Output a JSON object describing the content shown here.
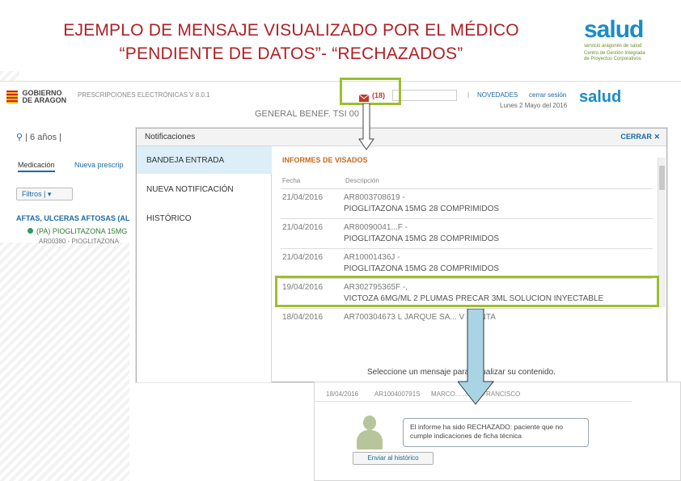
{
  "slide": {
    "title_line1": "EJEMPLO DE MENSAJE VISUALIZADO POR EL MÉDICO",
    "title_line2": "“PENDIENTE DE DATOS”- “RECHAZADOS”",
    "logo_text": "salud",
    "logo_sub": "servicio aragonés de salud",
    "logo_sub2": "Centro de Gestión Integrada de Proyectos Corporativos"
  },
  "app": {
    "org_logo_line1": "GOBIERNO",
    "org_logo_line2": "DE ARAGON",
    "app_title": "PRESCRIPCIONES ELECTRÓNICAS V 8.0.1",
    "notif_count": "(18)",
    "novedades": "NOVEDADES",
    "logout": "cerrar sesión",
    "date": "Lunes 2 Mayo del 2016",
    "patient_age": "6 años",
    "header_gray_text": "GENERAL BENEF. TSI 00",
    "tab_medicacion": "Medicación",
    "tab_nueva": "Nueva prescrip",
    "filter_btn": "Filtros",
    "section_left": "AFTAS, ULCERAS AFTOSAS (AL",
    "left_item1": "(PA) PIOGLITAZONA 15MG",
    "left_item2": "AR00380 - PIOGLITAZONA"
  },
  "dialog": {
    "title": "Notificaciones",
    "close_label": "CERRAR",
    "menu": [
      {
        "label": "BANDEJA ENTRADA"
      },
      {
        "label": "NUEVA NOTIFICACIÓN"
      },
      {
        "label": "HISTÓRICO"
      }
    ],
    "section_title": "INFORMES DE VISADOS",
    "columns": {
      "fecha": "Fecha",
      "descripcion": "Descripción"
    },
    "rows": [
      {
        "date": "21/04/2016",
        "code": "AR8003708619 -",
        "desc": "PIOGLITAZONA 15MG 28 COMPRIMIDOS"
      },
      {
        "date": "21/04/2016",
        "code": "AR80090041...F -",
        "desc": "PIOGLITAZONA 15MG 28 COMPRIMIDOS"
      },
      {
        "date": "21/04/2016",
        "code": "AR10001436J -",
        "desc": "PIOGLITAZONA 15MG 28 COMPRIMIDOS"
      },
      {
        "date": "19/04/2016",
        "code": "AR302795365F -,",
        "desc": "VICTOZA 6MG/ML 2 PLUMAS PRECAR 3ML SOLUCION INYECTABLE"
      },
      {
        "date": "18/04/2016",
        "code": "AR700304673 L JARQUE SA... V ICENTA",
        "desc": ""
      }
    ]
  },
  "lower": {
    "select_msg": "Seleccione un mensaje para visualizar su contenido.",
    "row_date": "18/04/2016",
    "row_code": "AR100400791S",
    "row_name": "MARCO... ...LAR FRANCISCO",
    "bubble_text": "El informe ha sido RECHAZADO: paciente que no cumple indicaciones de ficha técnica",
    "history_btn": "Enviar al histórico"
  },
  "colors": {
    "title_red": "#b01f24",
    "highlight_green": "#9cbf2d",
    "link_blue": "#1a6aa6",
    "accent_orange": "#c66a1e"
  }
}
